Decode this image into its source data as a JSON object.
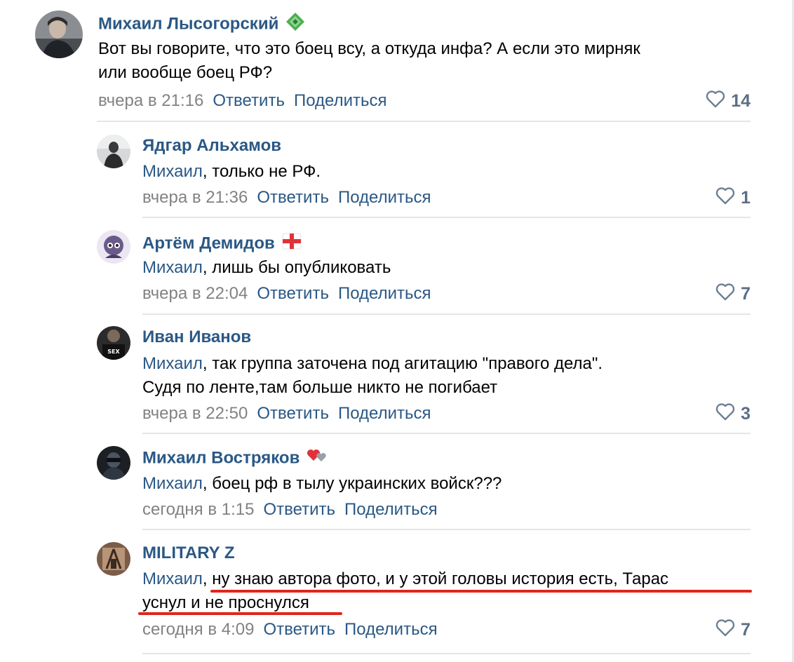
{
  "actions": {
    "reply": "Ответить",
    "share": "Поделиться"
  },
  "comments": [
    {
      "author": "Михаил Лысогорский",
      "badge_icon": "green-diamond-badge-icon",
      "mention": "",
      "text_line1": "Вот вы говорите, что это боец всу, а откуда инфа? А если это мирняк",
      "text_line2": "или вообще боец РФ?",
      "time": "вчера в 21:16",
      "likes": "14"
    },
    {
      "author": "Ядгар Альхамов",
      "mention": "Михаил",
      "text_line1": ", только не РФ.",
      "time": "вчера в 21:36",
      "likes": "1"
    },
    {
      "author": "Артём Демидов",
      "badge_icon": "red-cross-flag-badge-icon",
      "mention": "Михаил",
      "text_line1": ", лишь бы опубликовать",
      "time": "вчера в 22:04",
      "likes": "7"
    },
    {
      "author": "Иван Иванов",
      "mention": "Михаил",
      "text_line1": ", так группа заточена под агитацию \"правого дела\".",
      "text_line2": "Судя по ленте,там больше никто не погибает",
      "time": "вчера в 22:50",
      "likes": "3"
    },
    {
      "author": "Михаил Востряков",
      "badge_icon": "hearts-badge-icon",
      "mention": "Михаил",
      "text_line1": ", боец рф в тылу украинских войск???",
      "time": "сегодня в 1:15",
      "likes": ""
    },
    {
      "author": "MILITARY Z",
      "mention": "Михаил",
      "text_line1": ", ну знаю автора фото, и у этой головы история есть, Тарас",
      "text_line2": "уснул и не проснулся",
      "time": "сегодня в 4:09",
      "likes": "7"
    }
  ],
  "colors": {
    "link": "#2a5885",
    "meta": "#828282",
    "underline": "#e1251b"
  }
}
